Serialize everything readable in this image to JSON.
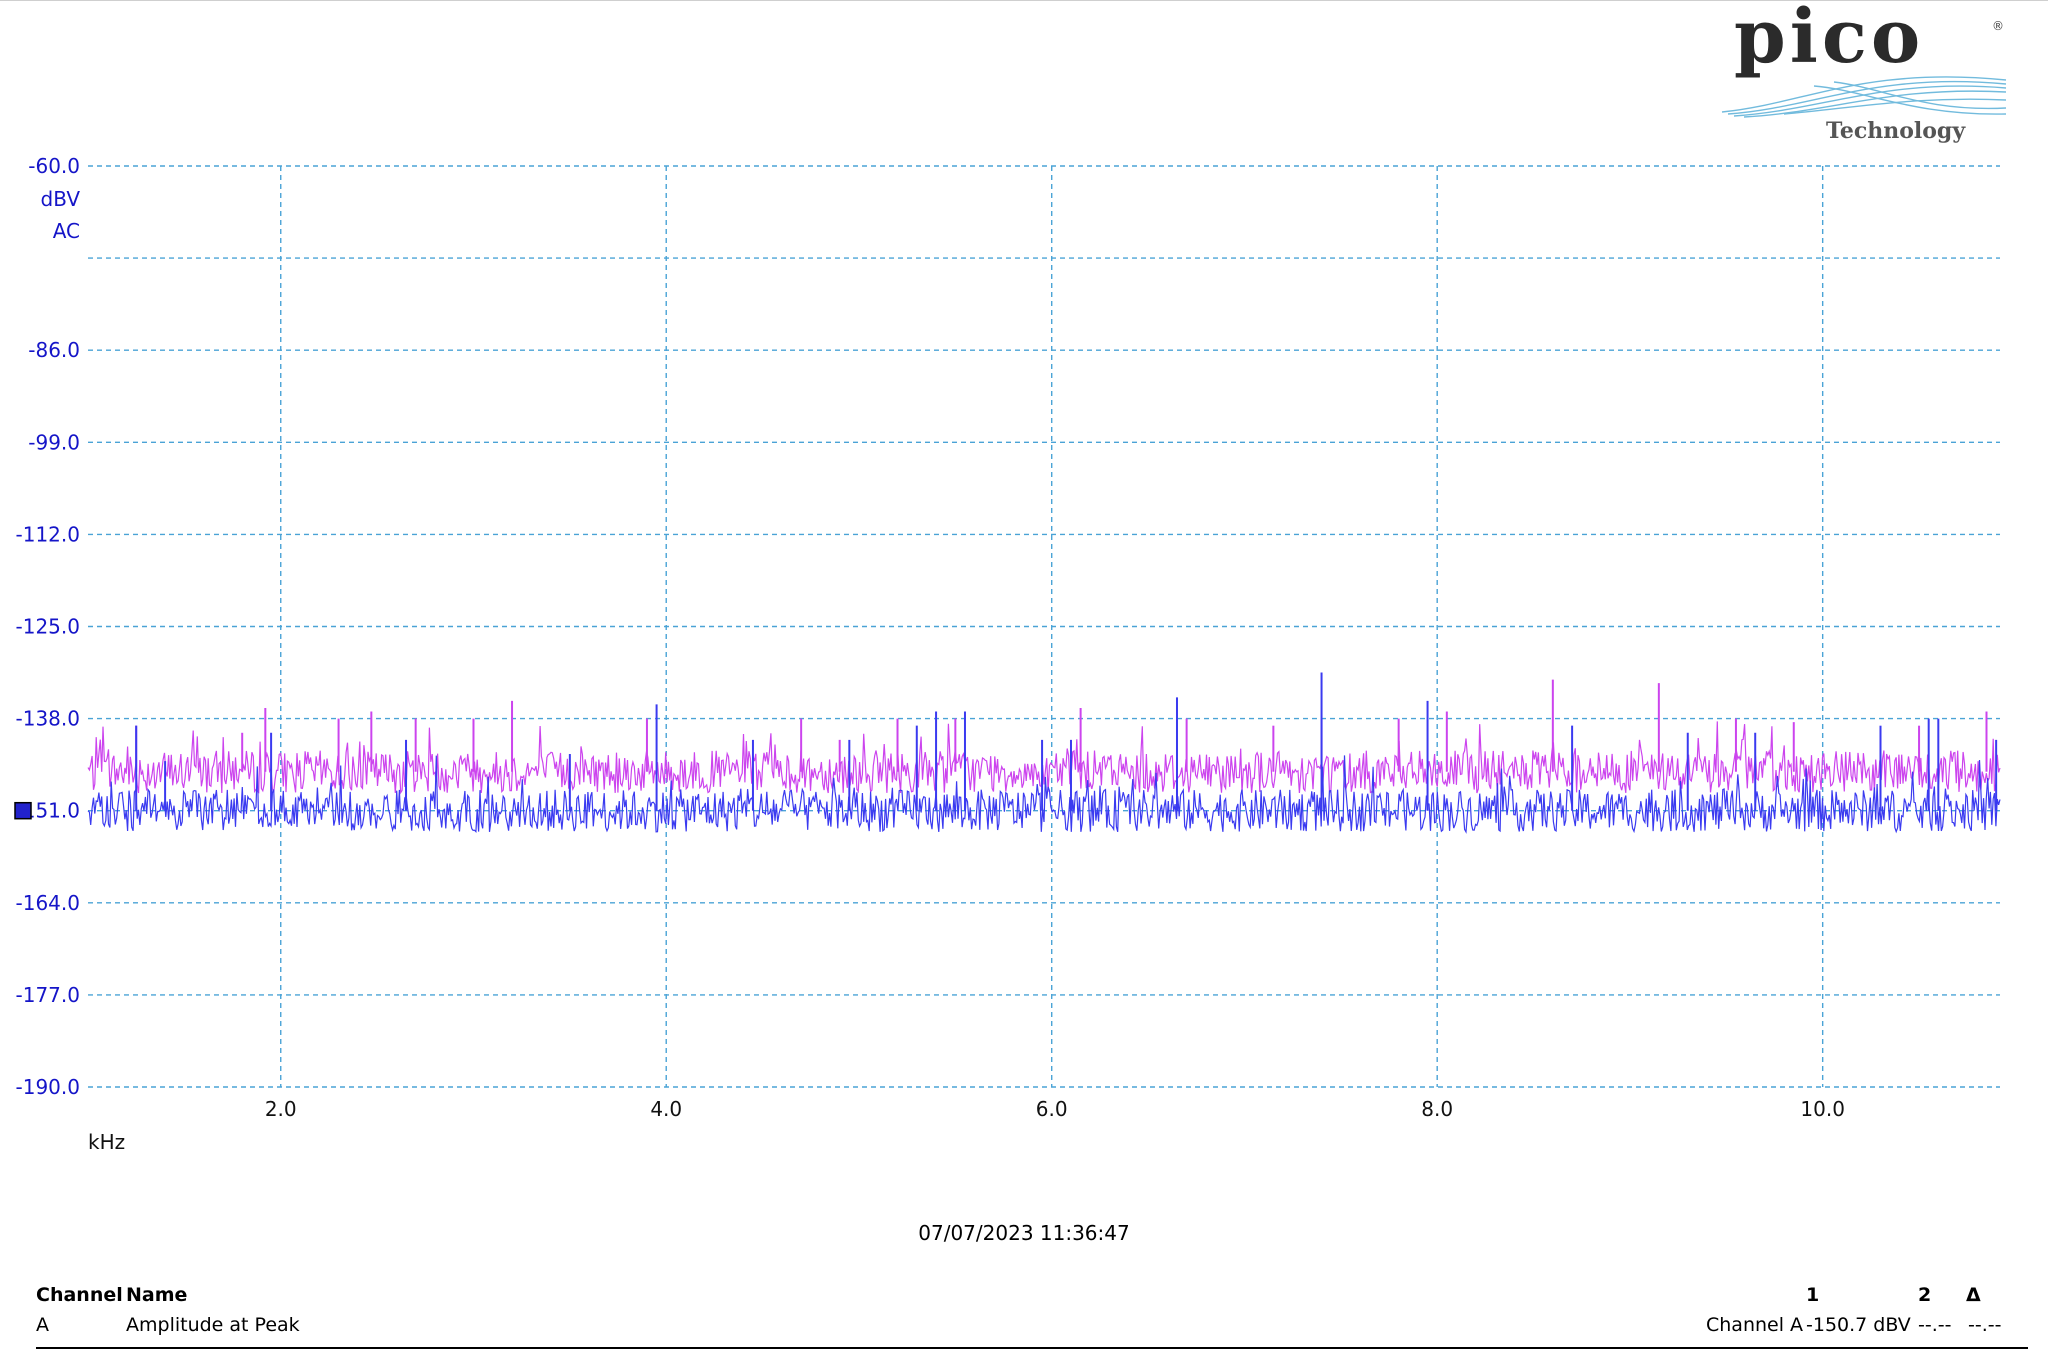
{
  "logo": {
    "brand": "pico",
    "tagline": "Technology"
  },
  "timestamp": "07/07/2023 11:36:47",
  "colors": {
    "axis_text": "#1515c8",
    "grid": "#4aa3d6",
    "series_a": "#3a3af0",
    "series_b": "#cc44ee",
    "marker": "#2222cc"
  },
  "y_axis_units": [
    "dBV",
    "AC"
  ],
  "x_axis_unit": "kHz",
  "measurements": {
    "headers": {
      "channel": "Channel",
      "name": "Name",
      "col1": "1",
      "col2": "2",
      "delta": "Δ"
    },
    "rows": [
      {
        "channel": "A",
        "name": "Amplitude at Peak",
        "source": "Channel A",
        "value1": "-150.7 dBV",
        "value2": "--.--",
        "delta": "--.--"
      }
    ]
  },
  "chart_data": {
    "type": "line",
    "title": "",
    "xlabel": "kHz",
    "ylabel": "dBV",
    "xlim": [
      1.0,
      10.92
    ],
    "ylim": [
      -190.0,
      -60.0
    ],
    "y_ticks": [
      -60.0,
      -86.0,
      -99.0,
      -112.0,
      -125.0,
      -138.0,
      -151.0,
      -164.0,
      -177.0,
      -190.0
    ],
    "y_tick_labels": [
      "-60.0",
      "-86.0",
      "-99.0",
      "-112.0",
      "-125.0",
      "-138.0",
      "151.0",
      "-164.0",
      "-177.0",
      "-190.0"
    ],
    "x_ticks": [
      2.0,
      4.0,
      6.0,
      8.0,
      10.0
    ],
    "x_tick_labels": [
      "2.0",
      "4.0",
      "6.0",
      "8.0",
      "10.0"
    ],
    "grid": true,
    "channel_marker_level": -151.0,
    "series": [
      {
        "baseline": -145.5,
        "color": "#cc44ee",
        "peaks": [
          [
            1.25,
            -139
          ],
          [
            1.8,
            -140
          ],
          [
            1.92,
            -136.5
          ],
          [
            2.3,
            -138
          ],
          [
            2.47,
            -137
          ],
          [
            2.7,
            -138
          ],
          [
            3.0,
            -138
          ],
          [
            3.2,
            -135.5
          ],
          [
            3.9,
            -138
          ],
          [
            4.7,
            -138
          ],
          [
            4.9,
            -141
          ],
          [
            5.2,
            -138
          ],
          [
            5.5,
            -138
          ],
          [
            6.15,
            -136.5
          ],
          [
            6.7,
            -138
          ],
          [
            7.15,
            -139
          ],
          [
            7.4,
            -138
          ],
          [
            7.8,
            -138
          ],
          [
            8.05,
            -137
          ],
          [
            8.6,
            -132.5
          ],
          [
            9.15,
            -133
          ],
          [
            9.55,
            -138
          ],
          [
            9.85,
            -138.5
          ],
          [
            10.5,
            -139
          ],
          [
            10.85,
            -137
          ]
        ]
      },
      {
        "baseline": -151.0,
        "color": "#3a3af0",
        "peaks": [
          [
            1.25,
            -139
          ],
          [
            1.4,
            -144
          ],
          [
            1.95,
            -140
          ],
          [
            2.65,
            -141
          ],
          [
            3.5,
            -143
          ],
          [
            3.95,
            -136
          ],
          [
            4.45,
            -141
          ],
          [
            4.95,
            -141
          ],
          [
            5.3,
            -139
          ],
          [
            5.4,
            -137
          ],
          [
            5.55,
            -137
          ],
          [
            5.95,
            -141
          ],
          [
            6.1,
            -141
          ],
          [
            6.65,
            -135
          ],
          [
            7.4,
            -131.5
          ],
          [
            7.95,
            -135.5
          ],
          [
            8.7,
            -139
          ],
          [
            9.3,
            -140
          ],
          [
            9.65,
            -140
          ],
          [
            10.3,
            -139
          ],
          [
            10.55,
            -138
          ],
          [
            10.6,
            -138
          ],
          [
            10.9,
            -141
          ]
        ]
      }
    ]
  }
}
